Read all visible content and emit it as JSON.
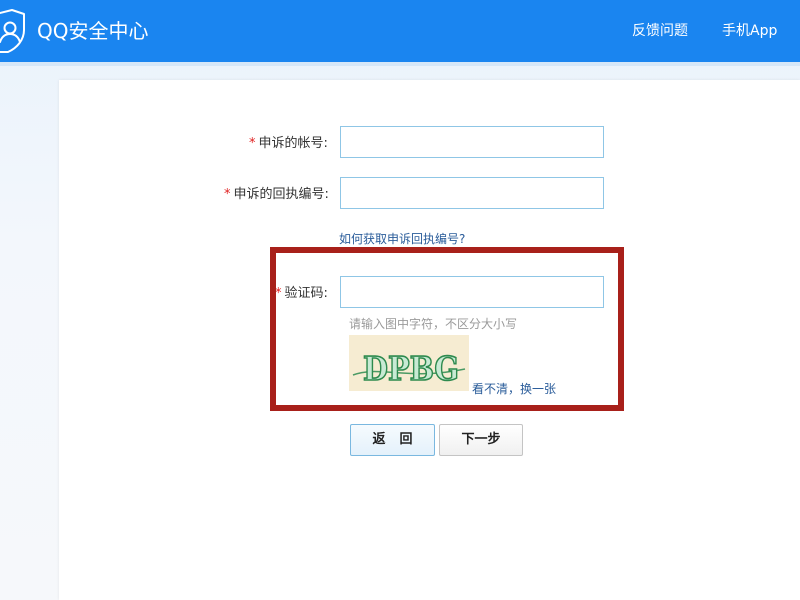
{
  "header": {
    "title": "QQ安全中心",
    "nav": {
      "feedback": "反馈问题",
      "mobile_app": "手机App"
    },
    "logo_icon": "shield-user-icon",
    "accent_color": "#1a85f0"
  },
  "form": {
    "account": {
      "required_mark": "*",
      "label": "申诉的帐号:",
      "value": ""
    },
    "receipt_number": {
      "required_mark": "*",
      "label": "申诉的回执编号:",
      "value": ""
    },
    "help_link": "如何获取申诉回执编号?",
    "captcha": {
      "required_mark": "*",
      "label": "验证码:",
      "value": "",
      "hint": "请输入图中字符，不区分大小写",
      "image_text": "DPBG",
      "refresh_link": "看不清，换一张"
    },
    "buttons": {
      "back": "返回",
      "next": "下一步"
    },
    "highlight_color": "#a8201a"
  }
}
